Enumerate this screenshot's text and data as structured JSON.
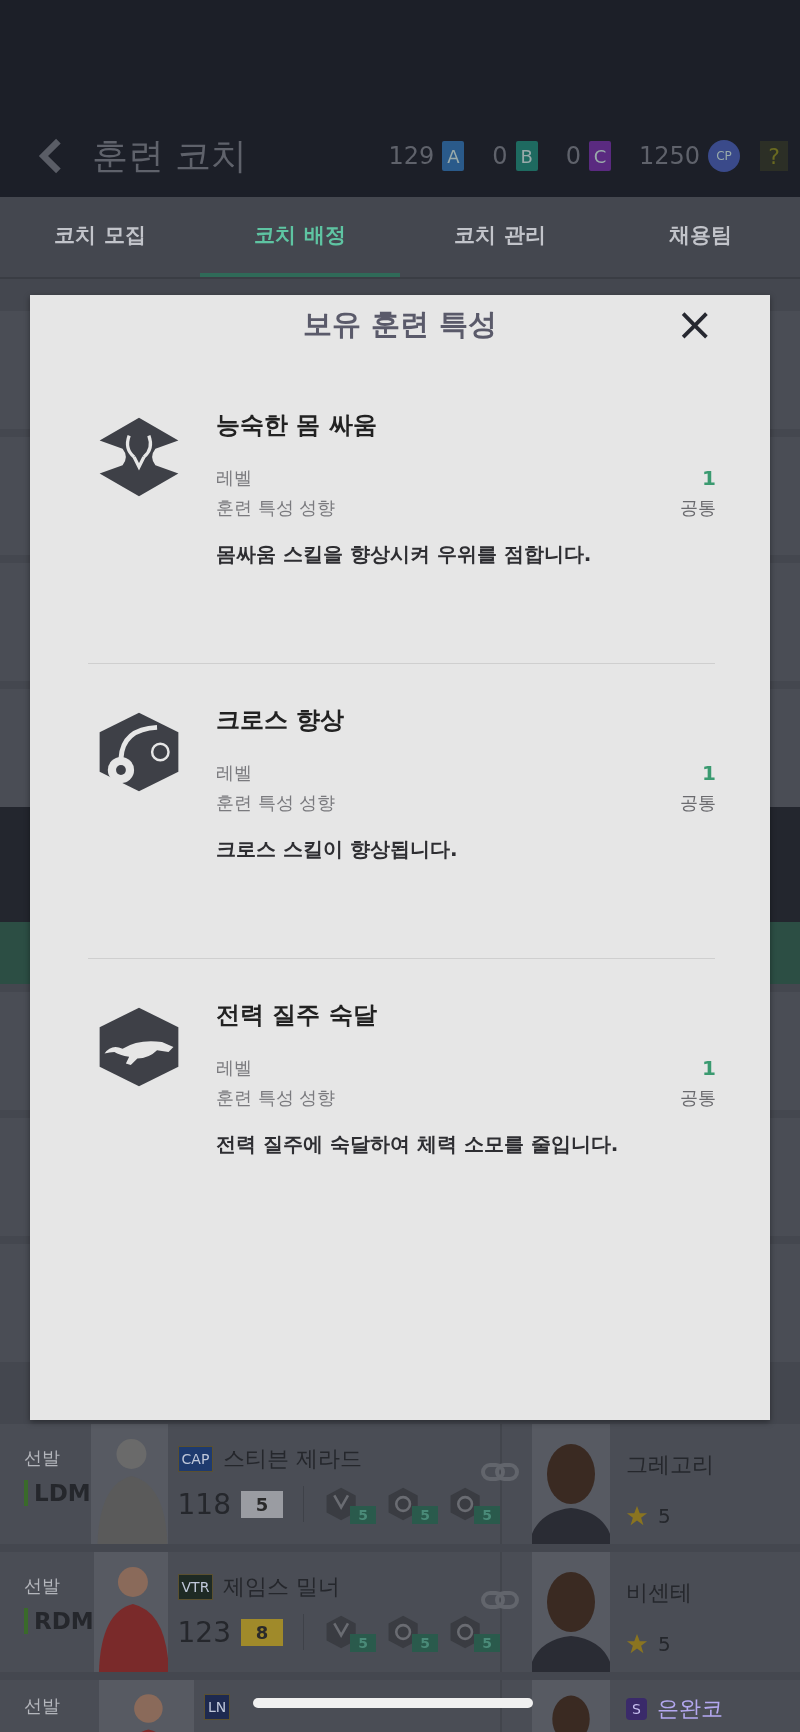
{
  "header": {
    "title": "훈련 코치",
    "currencies": [
      {
        "value": "129",
        "badge": "A",
        "color": "#2a5a8a"
      },
      {
        "value": "0",
        "badge": "B",
        "color": "#1e6a60"
      },
      {
        "value": "0",
        "badge": "C",
        "color": "#5a2a80"
      },
      {
        "value": "1250",
        "badge": "CP",
        "color": "#3a4a8a"
      }
    ],
    "help": "?"
  },
  "tabs": [
    {
      "label": "코치 모집",
      "selected": false
    },
    {
      "label": "코치 배정",
      "selected": true
    },
    {
      "label": "코치 관리",
      "selected": false
    },
    {
      "label": "채용팀",
      "selected": false
    }
  ],
  "modal": {
    "title": "보유 훈련 특성",
    "close": "×",
    "traits": [
      {
        "kind": "wrestle",
        "name": "능숙한 몸 싸움",
        "level_label": "레벨",
        "level": "1",
        "tendency_label": "훈련 특성 성향",
        "tendency": "공통",
        "description": "몸싸움 스킬을 향상시켜 우위를 점합니다."
      },
      {
        "kind": "cross",
        "name": "크로스 향상",
        "level_label": "레벨",
        "level": "1",
        "tendency_label": "훈련 특성 성향",
        "tendency": "공통",
        "description": "크로스 스킬이 향상됩니다."
      },
      {
        "kind": "sprint",
        "name": "전력 질주 숙달",
        "level_label": "레벨",
        "level": "1",
        "tendency_label": "훈련 특성 성향",
        "tendency": "공통",
        "description": "전력 질주에 숙달하여 체력 소모를 줄입니다."
      }
    ]
  },
  "players": [
    {
      "slot": "선발",
      "position": "LDM",
      "badge": {
        "label": "CAP",
        "color": "#1e3a6e"
      },
      "name": "스티븐 제라드",
      "ovr": "118",
      "grade": {
        "label": "5",
        "color": "#9a9ca2"
      },
      "skills": [
        {
          "kind": "wrestle",
          "level": "5"
        },
        {
          "kind": "cross",
          "level": "5"
        },
        {
          "kind": "pass",
          "level": "5"
        }
      ],
      "coach": {
        "name": "그레고리",
        "rating": "5"
      }
    },
    {
      "slot": "선발",
      "position": "RDM",
      "badge": {
        "label": "VTR",
        "color": "#1e2a24"
      },
      "name": "제임스 밀너",
      "ovr": "123",
      "grade": {
        "label": "8",
        "color": "#a08a2a"
      },
      "skills": [
        {
          "kind": "wrestle",
          "level": "5"
        },
        {
          "kind": "cross",
          "level": "5"
        },
        {
          "kind": "sprint",
          "level": "5"
        }
      ],
      "coach": {
        "name": "비센테",
        "rating": "5"
      }
    },
    {
      "slot": "선발",
      "badge": {
        "label": "LN",
        "color": "#1e2a50"
      },
      "coach": {
        "name": "은완코",
        "badge": "S"
      }
    }
  ]
}
